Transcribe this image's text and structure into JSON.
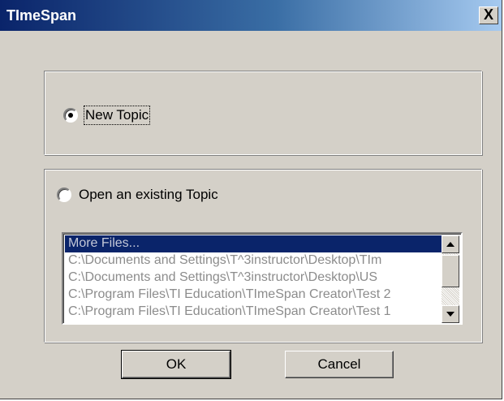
{
  "window": {
    "title": "TImeSpan",
    "close_label": "X"
  },
  "new_topic": {
    "label": "New Topic",
    "selected": true
  },
  "open_topic": {
    "label": "Open an existing Topic",
    "selected": false
  },
  "file_list": {
    "items": [
      "More Files...",
      "C:\\Documents and Settings\\T^3instructor\\Desktop\\TIm",
      "C:\\Documents and Settings\\T^3instructor\\Desktop\\US",
      "C:\\Program Files\\TI Education\\TImeSpan Creator\\Test 2",
      "C:\\Program Files\\TI Education\\TImeSpan Creator\\Test 1"
    ],
    "selected_index": 0
  },
  "buttons": {
    "ok_label": "OK",
    "cancel_label": "Cancel"
  },
  "colors": {
    "title_gradient_start": "#0a246a",
    "title_gradient_end": "#a6caf0",
    "dialog_face": "#d4d0c8",
    "selection": "#0a246a"
  }
}
